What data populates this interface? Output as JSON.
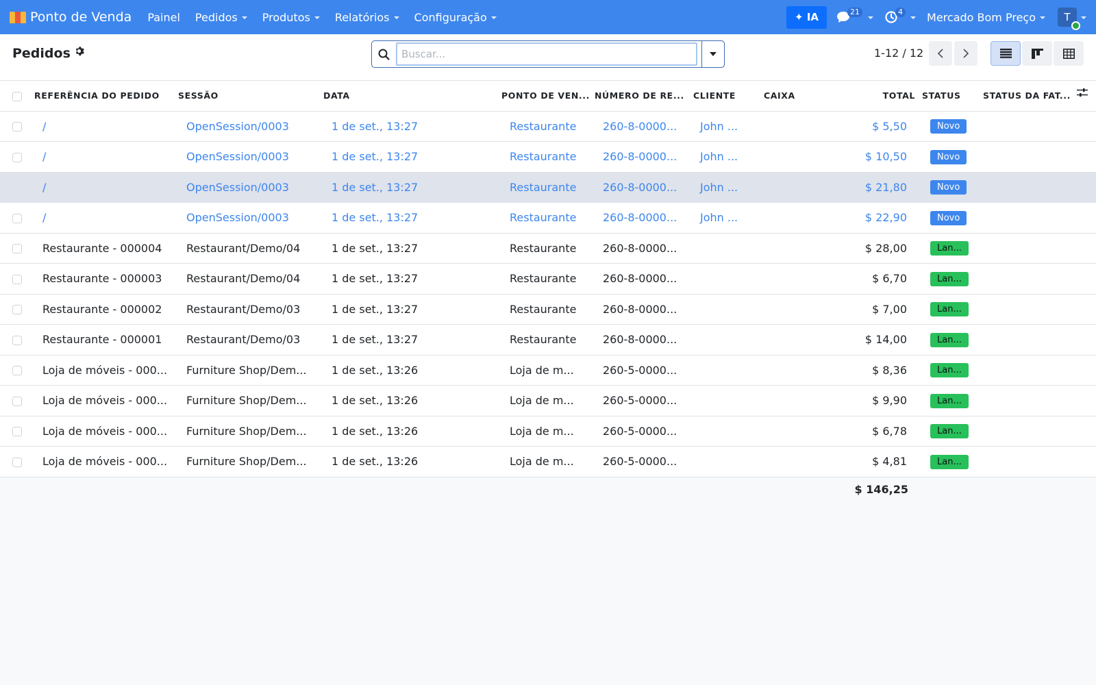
{
  "navbar": {
    "app_title": "Ponto de Venda",
    "menu": [
      {
        "label": "Painel",
        "has_caret": false
      },
      {
        "label": "Pedidos",
        "has_caret": true
      },
      {
        "label": "Produtos",
        "has_caret": true
      },
      {
        "label": "Relatórios",
        "has_caret": true
      },
      {
        "label": "Configuração",
        "has_caret": true
      }
    ],
    "ai_label": "✦ IA",
    "messages_count": "21",
    "activities_count": "4",
    "company": "Mercado Bom Preço",
    "avatar_initial": "T"
  },
  "control": {
    "page_title": "Pedidos",
    "search_placeholder": "Buscar...",
    "pager": "1-12 / 12"
  },
  "table": {
    "headers": {
      "ref": "REFERÊNCIA DO PEDIDO",
      "session": "SESSÃO",
      "date": "DATA",
      "pos": "PONTO DE VEN...",
      "receipt": "NÚMERO DE RE...",
      "customer": "CLIENTE",
      "cashier": "CAIXA",
      "total": "TOTAL",
      "status": "STATUS",
      "invoice_status": "STATUS DA FAT..."
    },
    "rows": [
      {
        "ref": "/",
        "session": "OpenSession/0003",
        "date": "1 de set., 13:27",
        "pos": "Restaurante",
        "receipt": "260-8-0000...",
        "customer": "John ...",
        "cashier": "",
        "total": "$ 5,50",
        "status": "Novo",
        "status_type": "new",
        "link": true,
        "hover": false
      },
      {
        "ref": "/",
        "session": "OpenSession/0003",
        "date": "1 de set., 13:27",
        "pos": "Restaurante",
        "receipt": "260-8-0000...",
        "customer": "John ...",
        "cashier": "",
        "total": "$ 10,50",
        "status": "Novo",
        "status_type": "new",
        "link": true,
        "hover": false
      },
      {
        "ref": "/",
        "session": "OpenSession/0003",
        "date": "1 de set., 13:27",
        "pos": "Restaurante",
        "receipt": "260-8-0000...",
        "customer": "John ...",
        "cashier": "",
        "total": "$ 21,80",
        "status": "Novo",
        "status_type": "new",
        "link": true,
        "hover": true
      },
      {
        "ref": "/",
        "session": "OpenSession/0003",
        "date": "1 de set., 13:27",
        "pos": "Restaurante",
        "receipt": "260-8-0000...",
        "customer": "John ...",
        "cashier": "",
        "total": "$ 22,90",
        "status": "Novo",
        "status_type": "new",
        "link": true,
        "hover": false
      },
      {
        "ref": "Restaurante - 000004",
        "session": "Restaurant/Demo/04",
        "date": "1 de set., 13:27",
        "pos": "Restaurante",
        "receipt": "260-8-0000...",
        "customer": "",
        "cashier": "",
        "total": "$ 28,00",
        "status": "Lan...",
        "status_type": "posted",
        "link": false,
        "hover": false
      },
      {
        "ref": "Restaurante - 000003",
        "session": "Restaurant/Demo/04",
        "date": "1 de set., 13:27",
        "pos": "Restaurante",
        "receipt": "260-8-0000...",
        "customer": "",
        "cashier": "",
        "total": "$ 6,70",
        "status": "Lan...",
        "status_type": "posted",
        "link": false,
        "hover": false
      },
      {
        "ref": "Restaurante - 000002",
        "session": "Restaurant/Demo/03",
        "date": "1 de set., 13:27",
        "pos": "Restaurante",
        "receipt": "260-8-0000...",
        "customer": "",
        "cashier": "",
        "total": "$ 7,00",
        "status": "Lan...",
        "status_type": "posted",
        "link": false,
        "hover": false
      },
      {
        "ref": "Restaurante - 000001",
        "session": "Restaurant/Demo/03",
        "date": "1 de set., 13:27",
        "pos": "Restaurante",
        "receipt": "260-8-0000...",
        "customer": "",
        "cashier": "",
        "total": "$ 14,00",
        "status": "Lan...",
        "status_type": "posted",
        "link": false,
        "hover": false
      },
      {
        "ref": "Loja de móveis - 000...",
        "session": "Furniture Shop/Dem...",
        "date": "1 de set., 13:26",
        "pos": "Loja de m...",
        "receipt": "260-5-0000...",
        "customer": "",
        "cashier": "",
        "total": "$ 8,36",
        "status": "Lan...",
        "status_type": "posted",
        "link": false,
        "hover": false
      },
      {
        "ref": "Loja de móveis - 000...",
        "session": "Furniture Shop/Dem...",
        "date": "1 de set., 13:26",
        "pos": "Loja de m...",
        "receipt": "260-5-0000...",
        "customer": "",
        "cashier": "",
        "total": "$ 9,90",
        "status": "Lan...",
        "status_type": "posted",
        "link": false,
        "hover": false
      },
      {
        "ref": "Loja de móveis - 000...",
        "session": "Furniture Shop/Dem...",
        "date": "1 de set., 13:26",
        "pos": "Loja de m...",
        "receipt": "260-5-0000...",
        "customer": "",
        "cashier": "",
        "total": "$ 6,78",
        "status": "Lan...",
        "status_type": "posted",
        "link": false,
        "hover": false
      },
      {
        "ref": "Loja de móveis - 000...",
        "session": "Furniture Shop/Dem...",
        "date": "1 de set., 13:26",
        "pos": "Loja de m...",
        "receipt": "260-5-0000...",
        "customer": "",
        "cashier": "",
        "total": "$ 4,81",
        "status": "Lan...",
        "status_type": "posted",
        "link": false,
        "hover": false
      }
    ],
    "grand_total": "$ 146,25"
  },
  "colors": {
    "navbar": "#3d86ee",
    "link": "#3d86ee",
    "badge_new": "#3d86ee",
    "badge_posted": "#28c05a",
    "hover_row": "#dfe3ec"
  },
  "icons": {
    "search": "search-icon",
    "gear": "gear-icon",
    "chat": "chat-icon",
    "activity": "clock-icon",
    "list_view": "list-view-icon",
    "kanban_view": "kanban-view-icon",
    "pivot_view": "pivot-view-icon",
    "optional_columns": "sliders-icon"
  }
}
